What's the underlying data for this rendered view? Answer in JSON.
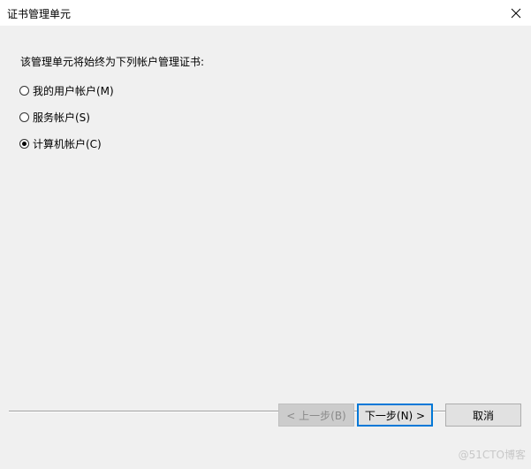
{
  "window": {
    "title": "证书管理单元"
  },
  "dialog": {
    "intro": "该管理单元将始终为下列帐户管理证书:",
    "options": [
      {
        "label": "我的用户帐户(M)",
        "checked": false
      },
      {
        "label": "服务帐户(S)",
        "checked": false
      },
      {
        "label": "计算机帐户(C)",
        "checked": true
      }
    ]
  },
  "buttons": {
    "back": "< 上一步(B)",
    "next": "下一步(N) >",
    "cancel": "取消"
  },
  "watermark": "@51CTO博客"
}
